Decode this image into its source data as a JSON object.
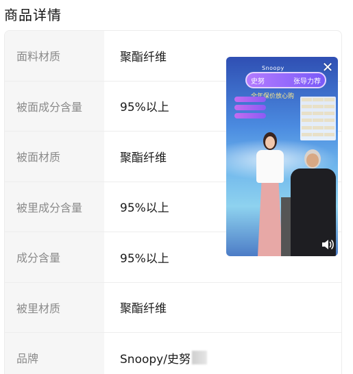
{
  "section": {
    "title": "商品详情"
  },
  "specs": [
    {
      "label": "面料材质",
      "value": "聚酯纤维"
    },
    {
      "label": "被面成分含量",
      "value": "95%以上"
    },
    {
      "label": "被面材质",
      "value": "聚酯纤维"
    },
    {
      "label": "被里成分含量",
      "value": "95%以上"
    },
    {
      "label": "成分含量",
      "value": "95%以上"
    },
    {
      "label": "被里材质",
      "value": "聚酯纤维"
    },
    {
      "label": "品牌",
      "value": "Snoopy/史努"
    }
  ],
  "video": {
    "banner_left": "史努",
    "banner_right": "张导力荐",
    "banner_top": "Snoopy",
    "subtitle": "全年保价放心购",
    "close_icon": "close-icon",
    "sound_icon": "speaker-icon"
  },
  "colors": {
    "label_bg": "#f6f6f6",
    "label_text": "#8a8a8a",
    "value_text": "#1a1a1a"
  }
}
